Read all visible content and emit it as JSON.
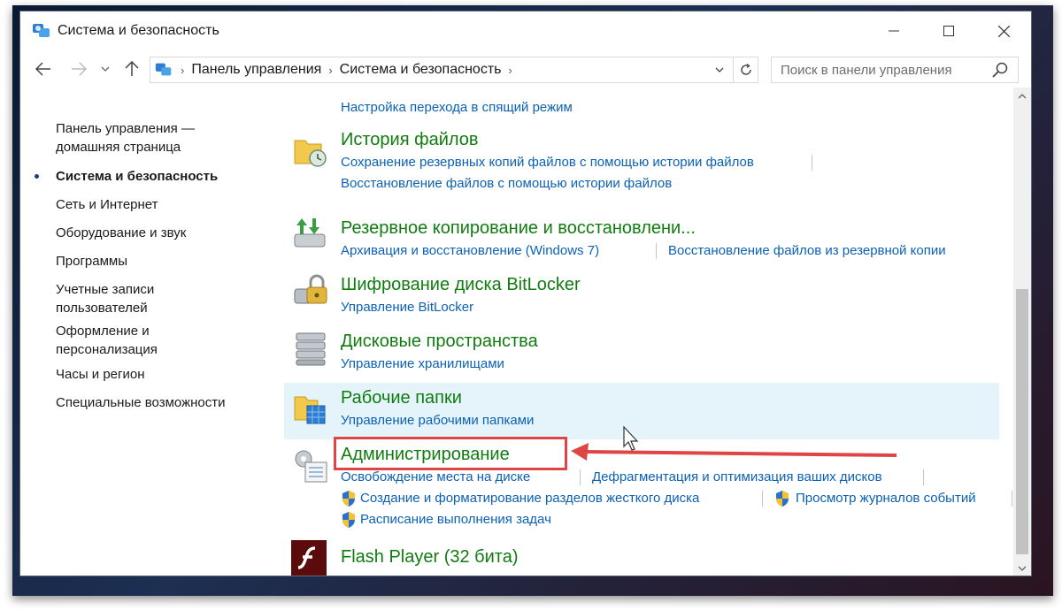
{
  "window": {
    "title": "Система и безопасность"
  },
  "address": {
    "crumbs": [
      "Панель управления",
      "Система и безопасность"
    ],
    "search_placeholder": "Поиск в панели управления"
  },
  "sidebar": {
    "items": [
      {
        "label": "Панель управления —\nдомашняя страница",
        "current": false
      },
      {
        "label": "Система и безопасность",
        "current": true
      },
      {
        "label": "Сеть и Интернет",
        "current": false
      },
      {
        "label": "Оборудование и звук",
        "current": false
      },
      {
        "label": "Программы",
        "current": false
      },
      {
        "label": "Учетные записи\nпользователей",
        "current": false
      },
      {
        "label": "Оформление и\nперсонализация",
        "current": false
      },
      {
        "label": "Часы и регион",
        "current": false
      },
      {
        "label": "Специальные возможности",
        "current": false
      }
    ]
  },
  "content": {
    "top_link": "Настройка перехода в спящий режим",
    "categories": [
      {
        "title": "История файлов",
        "links": [
          "Сохранение резервных копий файлов с помощью истории файлов",
          "Восстановление файлов с помощью истории файлов"
        ]
      },
      {
        "title": "Резервное копирование и восстановлени...",
        "links": [
          "Архивация и восстановление (Windows 7)",
          "Восстановление файлов из резервной копии"
        ]
      },
      {
        "title": "Шифрование диска BitLocker",
        "links": [
          "Управление BitLocker"
        ]
      },
      {
        "title": "Дисковые пространства",
        "links": [
          "Управление хранилищами"
        ]
      },
      {
        "title": "Рабочие папки",
        "links": [
          "Управление рабочими папками"
        ]
      },
      {
        "title": "Администрирование",
        "links": [
          "Освобождение места на диске",
          "Дефрагментация и оптимизация ваших дисков",
          "Создание и форматирование разделов жесткого диска",
          "Просмотр журналов событий",
          "Расписание выполнения задач"
        ]
      },
      {
        "title": "Flash Player (32 бита)",
        "links": []
      }
    ]
  },
  "colors": {
    "category_title": "#107c10",
    "link": "#0c61b4",
    "hover_bg": "#e5f3fb",
    "annotation_red": "#e04545"
  }
}
